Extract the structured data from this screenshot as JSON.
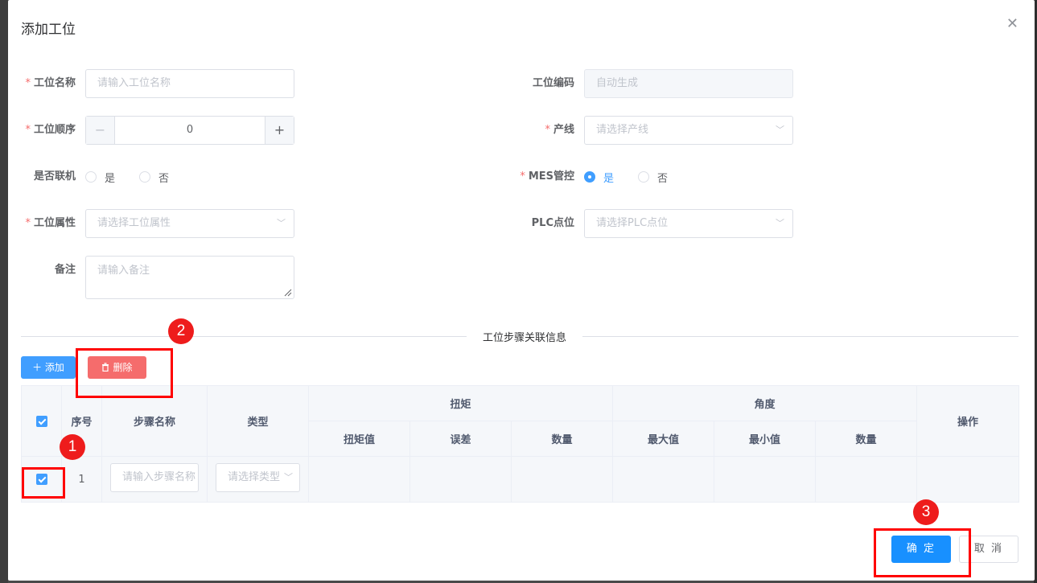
{
  "dialog": {
    "title": "添加工位",
    "close_icon": "close-icon"
  },
  "form": {
    "name": {
      "label": "工位名称",
      "required": true,
      "placeholder": "请输入工位名称"
    },
    "code": {
      "label": "工位编码",
      "placeholder": "自动生成"
    },
    "order": {
      "label": "工位顺序",
      "required": true,
      "value": "0",
      "minus": "−",
      "plus": "+"
    },
    "line": {
      "label": "产线",
      "required": true,
      "placeholder": "请选择产线"
    },
    "online": {
      "label": "是否联机",
      "options": [
        "是",
        "否"
      ]
    },
    "mes": {
      "label": "MES管控",
      "required": true,
      "options": [
        "是",
        "否"
      ],
      "selected": "是"
    },
    "attr": {
      "label": "工位属性",
      "required": true,
      "placeholder": "请选择工位属性"
    },
    "plc": {
      "label": "PLC点位",
      "placeholder": "请选择PLC点位"
    },
    "remark": {
      "label": "备注",
      "placeholder": "请输入备注"
    }
  },
  "section": {
    "title": "工位步骤关联信息"
  },
  "toolbar": {
    "add_label": "添加",
    "delete_label": "删除"
  },
  "table": {
    "headers": {
      "seq": "序号",
      "step_name": "步骤名称",
      "type": "类型",
      "torque": "扭矩",
      "angle": "角度",
      "action": "操作",
      "torque_value": "扭矩值",
      "tolerance": "误差",
      "qty": "数量",
      "max": "最大值",
      "min": "最小值",
      "qty2": "数量"
    },
    "rows": [
      {
        "seq": "1",
        "step_name_placeholder": "请输入步骤名称",
        "type_placeholder": "请选择类型"
      }
    ]
  },
  "annotations": [
    "1",
    "2",
    "3"
  ],
  "footer": {
    "ok_label": "确 定",
    "cancel_label": "取 消"
  }
}
